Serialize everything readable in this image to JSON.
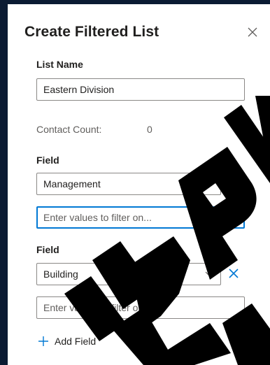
{
  "dialog": {
    "title": "Create Filtered List",
    "close_icon": "close-icon"
  },
  "list_name": {
    "label": "List Name",
    "value": "Eastern Division"
  },
  "contact_count": {
    "label": "Contact Count:",
    "value": "0"
  },
  "filters": [
    {
      "label": "Field",
      "selected": "Management",
      "values_placeholder": "Enter values to filter on..."
    },
    {
      "label": "Field",
      "selected": "Building",
      "values_placeholder": "Enter values to filter on..."
    }
  ],
  "add_field": {
    "label": "Add Field",
    "icon": "plus-icon"
  },
  "colors": {
    "accent": "#0078d4",
    "frame": "#0b1b33",
    "watermark": "#000000"
  }
}
